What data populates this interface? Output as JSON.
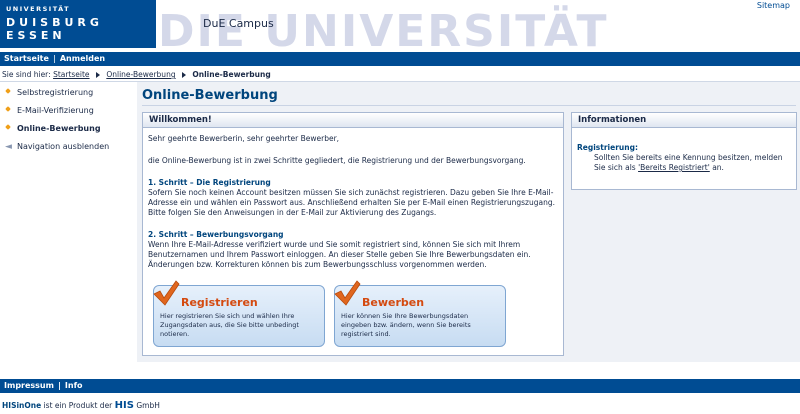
{
  "header": {
    "logo": {
      "line0": "UNIVERSITÄT",
      "line1": "DUISBURG",
      "line2": "ESSEN"
    },
    "watermark": "DIE UNIVERSITÄT",
    "campus": "DuE Campus",
    "sitemap": "Sitemap"
  },
  "navbar": {
    "start": "Startseite",
    "login": "Anmelden"
  },
  "breadcrumb": {
    "prefix": "Sie sind hier:",
    "items": [
      "Startseite",
      "Online-Bewerbung"
    ],
    "current": "Online-Bewerbung"
  },
  "sidebar": {
    "items": [
      "Selbstregistrierung",
      "E-Mail-Verifizierung",
      "Online-Bewerbung"
    ],
    "hide_nav": "Navigation ausblenden"
  },
  "main": {
    "title": "Online-Bewerbung",
    "welcome": {
      "heading": "Willkommen!",
      "greeting": "Sehr geehrte Bewerberin, sehr geehrter Bewerber,",
      "intro": "die Online-Bewerbung ist in zwei Schritte gegliedert, die Registrierung und der Bewerbungsvorgang.",
      "step1_title": "1. Schritt – Die Registrierung",
      "step1_text": "Sofern Sie noch keinen Account besitzen müssen Sie sich zunächst registrieren. Dazu geben Sie Ihre E-Mail-Adresse ein und wählen ein Passwort aus. Anschließend erhalten Sie per E-Mail einen Registrierungszugang. Bitte folgen Sie den Anweisungen in der E-Mail zur Aktivierung des Zugangs.",
      "step2_title": "2. Schritt – Bewerbungsvorgang",
      "step2_text": "Wenn Ihre E-Mail-Adresse verifiziert wurde und Sie somit registriert sind, können Sie sich mit Ihrem Benutzernamen und Ihrem Passwort einloggen. An dieser Stelle geben Sie Ihre Bewerbungsdaten ein. Änderungen bzw. Korrekturen können bis zum Bewerbungsschluss vorgenommen werden.",
      "register": {
        "title": "Registrieren",
        "desc": "Hier registrieren Sie sich und wählen Ihre Zugangsdaten aus, die Sie bitte unbedingt notieren."
      },
      "apply": {
        "title": "Bewerben",
        "desc": "Hier können Sie Ihre Bewerbungsdaten eingeben bzw. ändern, wenn Sie bereits registriert sind."
      }
    },
    "info": {
      "heading": "Informationen",
      "label": "Registrierung:",
      "text_before": "Sollten Sie bereits eine Kennung besitzen, melden Sie sich als",
      "link": "'Bereits Registriert'",
      "text_after": "an."
    }
  },
  "footer": {
    "impressum": "Impressum",
    "info": "Info"
  },
  "credit": {
    "brand": "HISinOne",
    "text": "ist ein Produkt der",
    "his": "HIS",
    "gmbh": "GmbH"
  },
  "colors": {
    "primary": "#004c93",
    "accent": "#d44a10",
    "bullet": "#f0a019"
  }
}
